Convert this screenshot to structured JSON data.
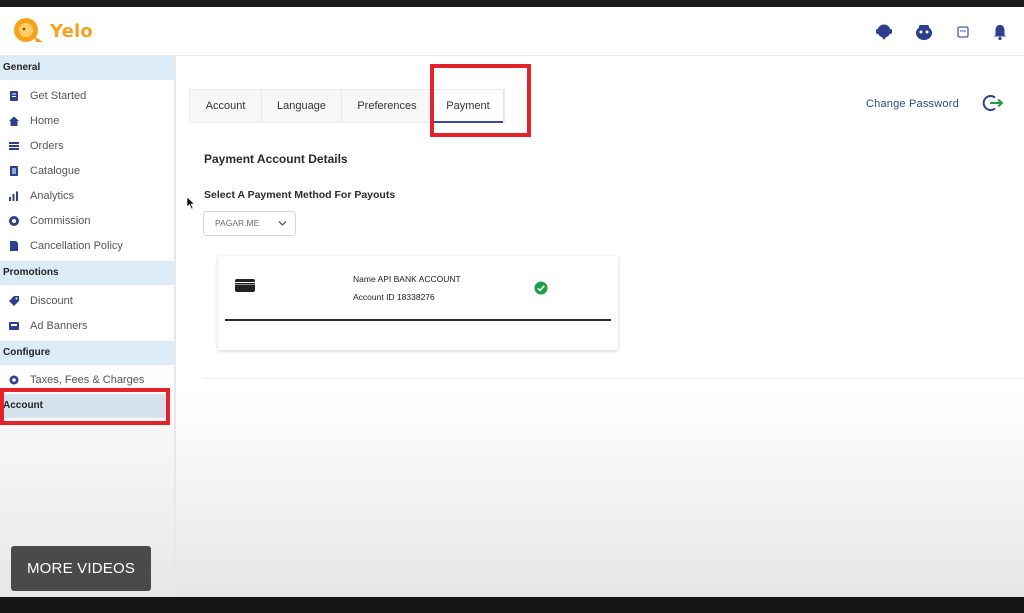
{
  "app": {
    "name": "Yelo",
    "brand_color": "#f5a21a"
  },
  "header": {
    "icons": [
      "support-chat-icon",
      "user-avatar-icon",
      "calendar-icon",
      "notification-bell-icon"
    ]
  },
  "sidebar": {
    "sections": {
      "general": "General",
      "promotions": "Promotions",
      "configure": "Configure",
      "account": "Account"
    },
    "items": {
      "get_started": "Get Started",
      "home": "Home",
      "orders": "Orders",
      "catalogue": "Catalogue",
      "analytics": "Analytics",
      "commission": "Commission",
      "cancellation_policy": "Cancellation Policy",
      "discount": "Discount",
      "ad_banners": "Ad Banners",
      "taxes": "Taxes, Fees & Charges"
    }
  },
  "tabs": {
    "account": "Account",
    "language": "Language",
    "preferences": "Preferences",
    "payment": "Payment",
    "active": "Payment"
  },
  "change_password": "Change Password",
  "payment": {
    "title": "Payment Account Details",
    "select_label": "Select A Payment Method For Payouts",
    "method": "PAGAR.ME",
    "card": {
      "name_line": "Name API BANK ACCOUNT",
      "account_line": "Account ID 18338276",
      "verified": true
    }
  },
  "overlay": {
    "more_videos": "MORE VIDEOS"
  },
  "colors": {
    "highlight": "#e3222a",
    "section_bg": "#dcecf7",
    "accent_blue": "#3a4b9f",
    "check_green": "#1e9e4a"
  }
}
